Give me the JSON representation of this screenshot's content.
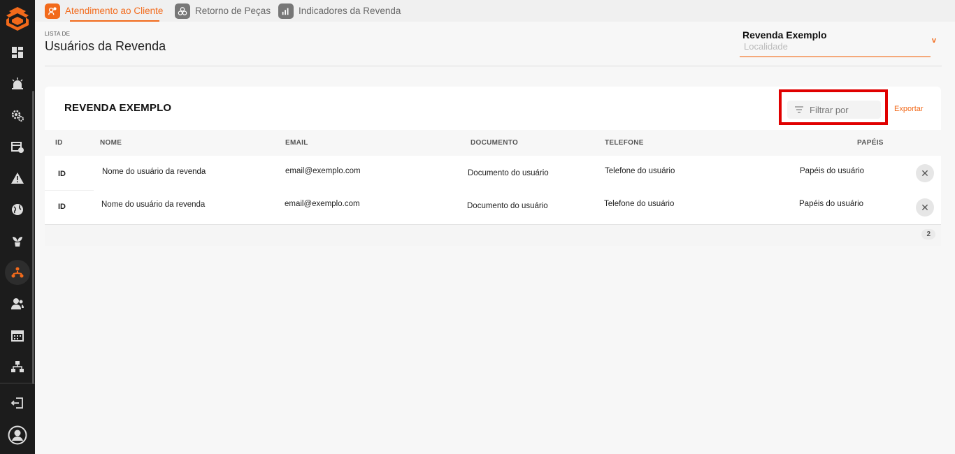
{
  "tabs": [
    {
      "label": "Atendimento ao Cliente",
      "icon": "customer-service-icon",
      "active": true
    },
    {
      "label": "Retorno de Peças",
      "icon": "parts-return-icon",
      "active": false
    },
    {
      "label": "Indicadores da Revenda",
      "icon": "bar-chart-icon",
      "active": false
    }
  ],
  "header": {
    "eyebrow": "LISTA DE",
    "title": "Usuários da Revenda"
  },
  "store_selector": {
    "name": "Revenda Exemplo",
    "placeholder": "Localidade"
  },
  "card": {
    "title": "REVENDA EXEMPLO",
    "filter_placeholder": "Filtrar por",
    "export_label": "Exportar"
  },
  "table": {
    "columns": [
      "ID",
      "NOME",
      "EMAIL",
      "DOCUMENTO",
      "TELEFONE",
      "PAPÉIS"
    ],
    "rows": [
      {
        "id": "ID",
        "name": "Nome do usuário da revenda",
        "email": "email@exemplo.com",
        "document": "Documento do usuário",
        "phone": "Telefone do usuário",
        "roles": "Papéis do usuário"
      },
      {
        "id": "ID",
        "name": "Nome do usuário da revenda",
        "email": "email@exemplo.com",
        "document": "Documento do usuário",
        "phone": "Telefone do usuário",
        "roles": "Papéis do usuário"
      }
    ],
    "total_count": "2"
  },
  "sidebar": {
    "icons": [
      "dashboard-icon",
      "alarm-icon",
      "settings-gears-icon",
      "calendar-clock-icon",
      "warning-icon",
      "globe-icon",
      "plant-icon",
      "people-network-icon",
      "user-group-icon",
      "calendar-icon",
      "hierarchy-icon",
      "logout-icon",
      "profile-icon"
    ]
  },
  "colors": {
    "accent": "#f26a1b",
    "sidebar_bg": "#1c1c1c",
    "highlight": "#e00000"
  }
}
